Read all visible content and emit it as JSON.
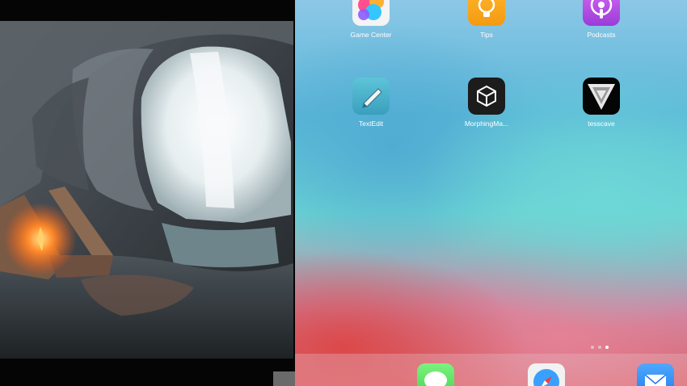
{
  "home_screen": {
    "apps": [
      {
        "label": "Game Center",
        "icon": "game-center-icon"
      },
      {
        "label": "Tips",
        "icon": "tips-icon"
      },
      {
        "label": "Podcasts",
        "icon": "podcasts-icon"
      },
      {
        "label": "TextEdit",
        "icon": "textedit-icon"
      },
      {
        "label": "MorphingMa...",
        "icon": "unity-icon"
      },
      {
        "label": "tesscave",
        "icon": "tesscave-icon"
      }
    ],
    "page_dots": {
      "count": 3,
      "active_index": 2
    },
    "dock": [
      {
        "icon": "messages-icon"
      },
      {
        "icon": "safari-icon"
      },
      {
        "icon": "mail-icon"
      }
    ]
  },
  "video": {
    "subject": "cave-scene"
  }
}
